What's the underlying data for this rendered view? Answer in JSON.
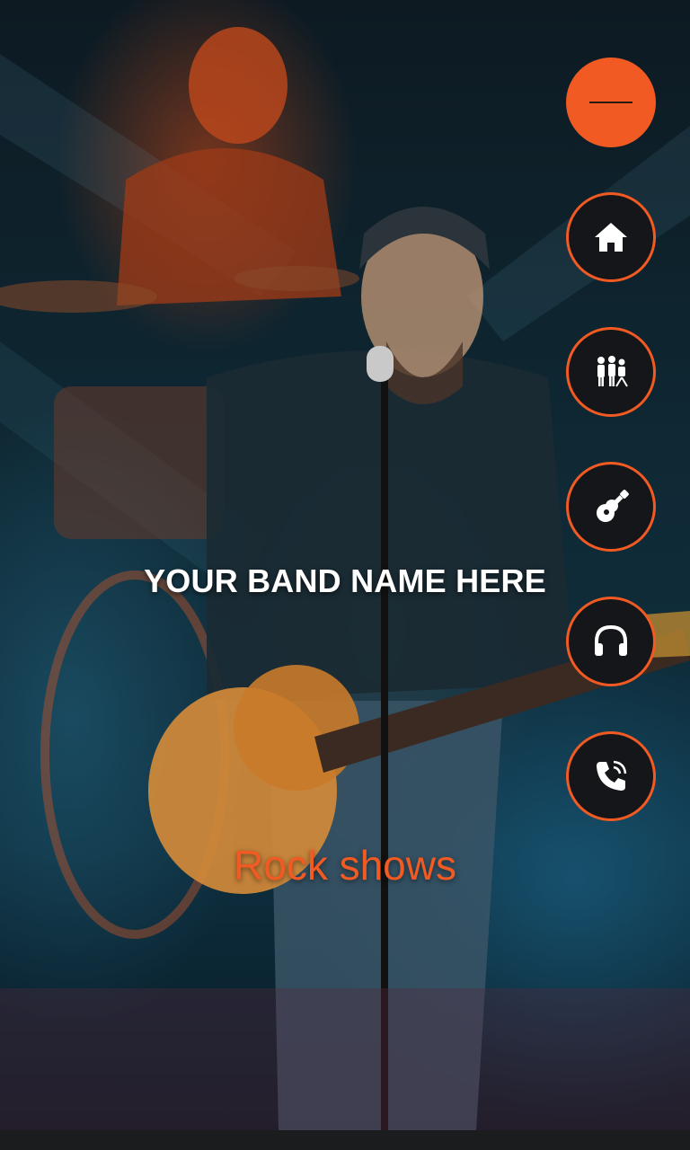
{
  "hero": {
    "band_name": "YOUR BAND NAME HERE",
    "tagline": "Rock shows"
  },
  "menu": {
    "toggle_icon": "hamburger-icon",
    "items": [
      {
        "icon": "home-icon"
      },
      {
        "icon": "band-icon"
      },
      {
        "icon": "guitar-icon"
      },
      {
        "icon": "headphones-icon"
      },
      {
        "icon": "phone-icon"
      }
    ]
  },
  "colors": {
    "accent": "#f15a22",
    "button_bg": "#151619",
    "text": "#ffffff"
  }
}
